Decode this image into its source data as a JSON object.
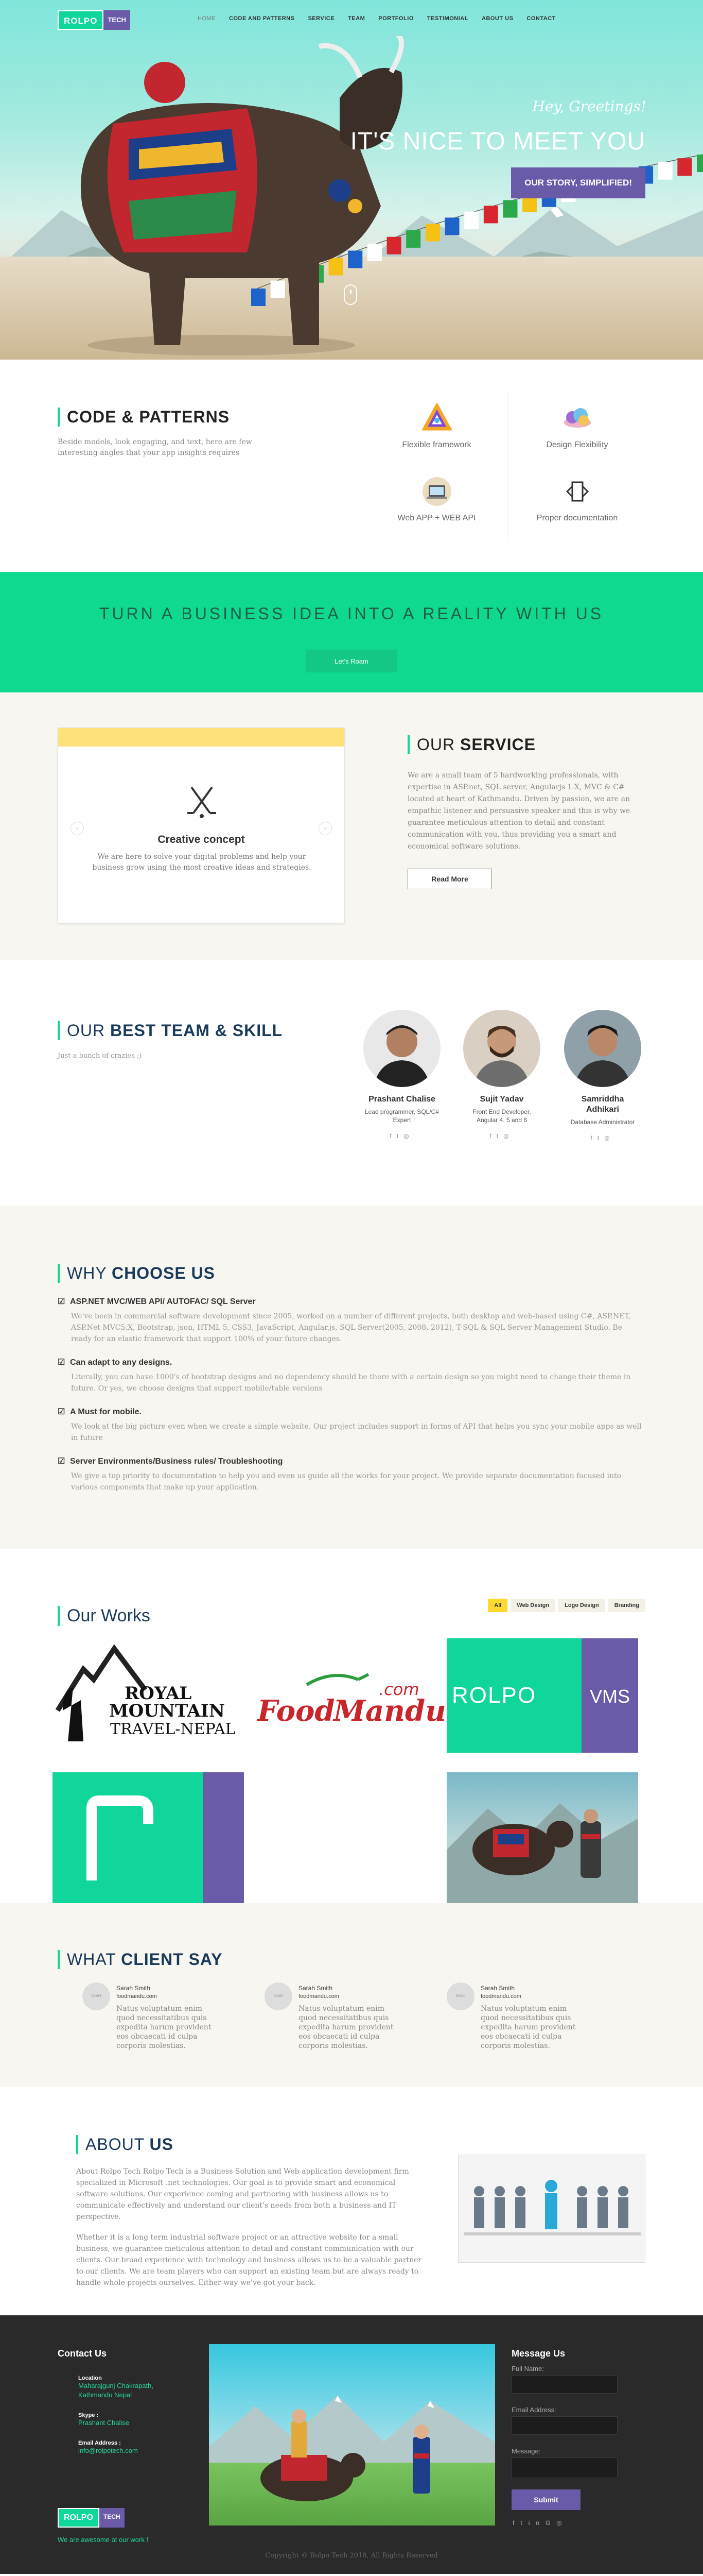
{
  "brand": {
    "logo_main": "ROLPO",
    "logo_sub": "TECH"
  },
  "nav": {
    "items": [
      {
        "label": "HOME"
      },
      {
        "label": "CODE AND PATTERNS"
      },
      {
        "label": "SERVICE"
      },
      {
        "label": "TEAM"
      },
      {
        "label": "PORTFOLIO"
      },
      {
        "label": "TESTIMONIAL"
      },
      {
        "label": "ABOUT US"
      },
      {
        "label": "CONTACT"
      }
    ]
  },
  "hero": {
    "greeting": "Hey, Greetings!",
    "title": "IT'S NICE TO MEET YOU",
    "button": "OUR STORY, SIMPLIFIED!"
  },
  "code_patterns": {
    "title": "CODE & PATTERNS",
    "description": "Beside models, look engaging, and text, here are few interesting angles that your app insights requires",
    "features": [
      {
        "label": "Flexible framework",
        "icon": "flexible-framework-icon"
      },
      {
        "label": "Design Flexibility",
        "icon": "design-flexibility-icon"
      },
      {
        "label": "Web APP + WEB API",
        "icon": "web-app-icon"
      },
      {
        "label": "Proper documentation",
        "icon": "documentation-icon"
      }
    ]
  },
  "banner": {
    "title": "TURN A BUSINESS IDEA INTO A REALITY WITH US",
    "button": "Let’s Roam"
  },
  "service": {
    "title_light": "OUR ",
    "title_bold": "SERVICE",
    "card_title": "Creative concept",
    "card_desc": "We are here to solve your digital problems and help your business grow using the most creative ideas and strategies.",
    "description": "We are a small team of 5 hardworking professionals, with expertise in ASP.net, SQL server, Angularjs 1.X, MVC & C# located at heart of Kathmandu. Driven by passion, we are an empathic listener and persuasive speaker and this is why we guarantee meticulous attention to detail and constant communication with you, thus providing you a smart and economical software solutions.",
    "button": "Read More"
  },
  "team": {
    "title_light": "OUR ",
    "title_bold": "BEST TEAM & SKILL",
    "subtitle": "Just a bunch of crazies ;)",
    "members": [
      {
        "name": "Prashant Chalise",
        "role": "Lead programmer, SQL/C# Expert"
      },
      {
        "name": "Sujit Yadav",
        "role": "Front End Developer, Angular 4, 5 and 6"
      },
      {
        "name": "Samriddha Adhikari",
        "role": "Database Administrator"
      }
    ]
  },
  "why": {
    "title_light": "WHY ",
    "title_bold": "CHOOSE US",
    "items": [
      {
        "title": "ASP.NET MVC/WEB API/ AUTOFAC/ SQL Server",
        "text": "We've been in commercial software development since 2005, worked on a number of different projects, both desktop and web-based using C#, ASP.NET, ASP.Net MVC5.X, Bootstrap, json, HTML 5, CSS3, JavaScript, Angular.js, SQL Server(2005, 2008, 2012), T-SQL & SQL Server Management Studio. Be ready for an elastic framework that support 100% of your future changes."
      },
      {
        "title": "Can adapt to any designs.",
        "text": "Literally, you can have 1000's of bootstrap designs and no dependency should be there with a certain design so you might need to change their theme in future. Or yes, we choose designs that support mobile/table versions"
      },
      {
        "title": "A Must for mobile.",
        "text": "We look at the big picture even when we create a simple website. Our project includes support in forms of API that helps you sync your mobile apps as well in future"
      },
      {
        "title": "Server Environments/Business rules/ Troubleshooting",
        "text": "We give a top priority to documentation to help you and even us guide all the works for your project. We provide separate documentation focused into various components that make up your application."
      }
    ]
  },
  "works": {
    "title": "Our Works",
    "filters": [
      "All",
      "Web Design",
      "Logo Design",
      "Branding"
    ],
    "items": [
      {
        "line1": "ROYAL",
        "line2": "MOUNTAIN",
        "line3": "TRAVEL-NEPAL"
      },
      {
        "line1": "Food",
        "line2": "Mandu",
        "line3": ".com"
      },
      {
        "line1": "ROLPO",
        "line2": "VMS"
      }
    ]
  },
  "client": {
    "title_light": "WHAT ",
    "title_bold": "CLIENT SAY",
    "avatar_text": "64x64",
    "items": [
      {
        "name": "Sarah Smith",
        "site": "foodmandu.com",
        "quote": "Natus voluptatum enim quod necessitatibus quis expedita harum provident eos obcaecati id culpa corporis molestias."
      },
      {
        "name": "Sarah Smith",
        "site": "foodmandu.com",
        "quote": "Natus voluptatum enim quod necessitatibus quis expedita harum provident eos obcaecati id culpa corporis molestias."
      },
      {
        "name": "Sarah Smith",
        "site": "foodmandu.com",
        "quote": "Natus voluptatum enim quod necessitatibus quis expedita harum provident eos obcaecati id culpa corporis molestias."
      }
    ]
  },
  "about": {
    "title_light": "ABOUT ",
    "title_bold": "US",
    "p1": "About Rolpo Tech Rolpo Tech is a Business Solution and Web application development firm specialized in Microsoft .net technologies. Our goal is to provide smart and economical software solutions. Our experience coming and partnering with business allows us to communicate effectively and understand our client's needs from both a business and IT perspective.",
    "p2": "Whether it is a long term industrial software project or an attractive website for a small business, we guarantee meticulous attention to detail and constant communication with our clients. Our broad experience with technology and business allows us to be a valuable partner to our clients. We are team players who can support an existing team but are always ready to handle whole projects ourselves. Either way we've got your back."
  },
  "footer": {
    "contact_title": "Contact Us",
    "location_label": "Location",
    "location_value": "Maharajgunj Chakrapath, Kathmandu Nepal",
    "skype_label": "Skype :",
    "skype_value": "Prashant Chalise",
    "email_label": "Email Address :",
    "email_value": "info@rolpotech.com",
    "tagline": "We are awesome at our work !",
    "message_title": "Message Us",
    "name_label": "Full Name:",
    "email_field_label": "Email Address:",
    "message_label": "Message:",
    "submit": "Submit",
    "copyright": "Copyright © Rolpo Tech 2018, All Rights Reserved"
  }
}
